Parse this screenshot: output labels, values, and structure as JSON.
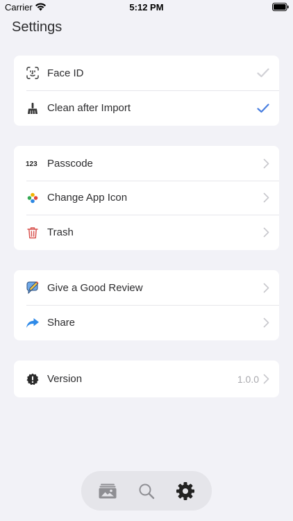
{
  "status_bar": {
    "carrier": "Carrier",
    "time": "5:12 PM",
    "icons": [
      "wifi-icon",
      "battery-icon"
    ]
  },
  "header": {
    "title": "Settings"
  },
  "groups": [
    {
      "items": [
        {
          "label": "Face ID",
          "icon": "face-id-icon",
          "accessory": "checkmark",
          "checked": false
        },
        {
          "label": "Clean after Import",
          "icon": "broom-icon",
          "accessory": "checkmark",
          "checked": true
        }
      ]
    },
    {
      "items": [
        {
          "label": "Passcode",
          "icon": "passcode-123-icon",
          "accessory": "chevron"
        },
        {
          "label": "Change App Icon",
          "icon": "app-icon-flower-icon",
          "accessory": "chevron"
        },
        {
          "label": "Trash",
          "icon": "trash-icon",
          "accessory": "chevron"
        }
      ]
    },
    {
      "items": [
        {
          "label": "Give a Good Review",
          "icon": "review-pen-icon",
          "accessory": "chevron"
        },
        {
          "label": "Share",
          "icon": "share-arrow-icon",
          "accessory": "chevron"
        }
      ]
    },
    {
      "items": [
        {
          "label": "Version",
          "icon": "version-badge-icon",
          "accessory": "chevron",
          "value": "1.0.0"
        }
      ]
    }
  ],
  "tab_bar": {
    "tabs": [
      {
        "icon": "photo-album-icon",
        "selected": false
      },
      {
        "icon": "search-icon",
        "selected": false
      },
      {
        "icon": "gear-icon",
        "selected": true
      }
    ]
  },
  "colors": {
    "background": "#f2f2f7",
    "card": "#ffffff",
    "accent_check": "#4a7fe0",
    "inactive_check": "#d1d1d6",
    "chevron": "#c7c7cc",
    "trash_red": "#d9534f",
    "share_blue": "#2f8ae8",
    "tab_bar": "#e5e5ea",
    "tab_selected": "#222222",
    "tab_unselected": "#8e8e93"
  }
}
